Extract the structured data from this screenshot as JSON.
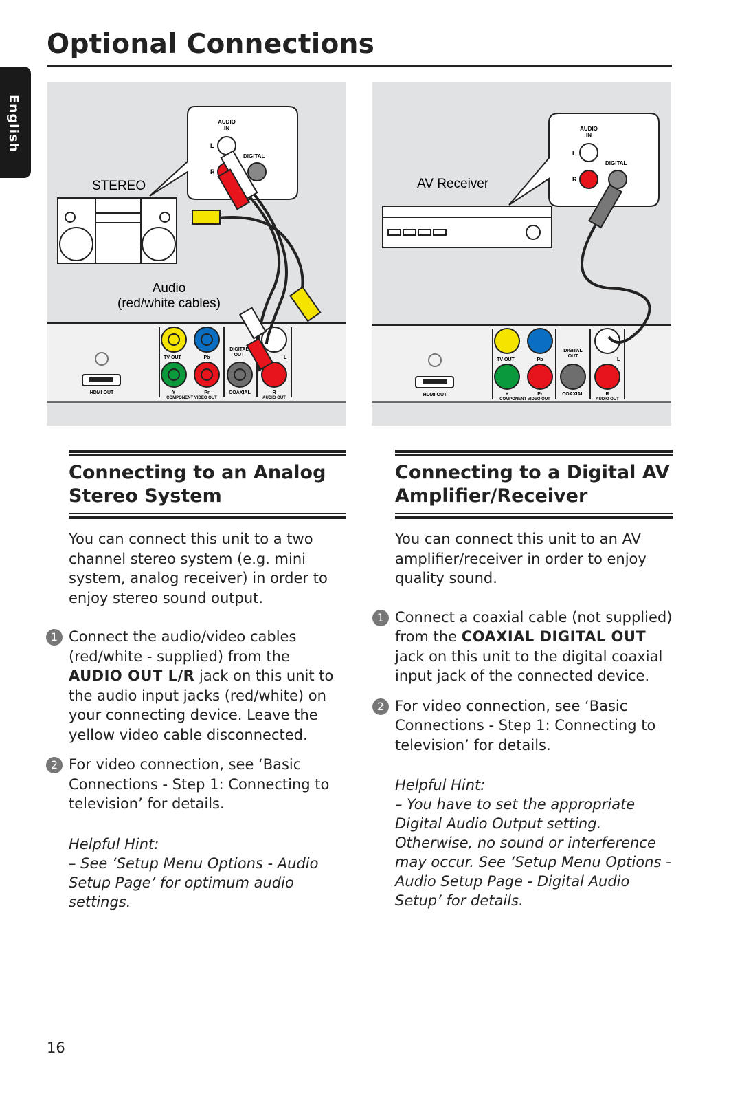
{
  "page": {
    "title": "Optional Connections",
    "language_tab": "English",
    "page_number": "16"
  },
  "diagram_left": {
    "device_label": "STEREO",
    "cable_label_1": "Audio",
    "cable_label_2": "(red/white cables)",
    "audio_in": "AUDIO",
    "audio_in2": "IN",
    "l": "L",
    "r": "R",
    "digital": "DIGITAL",
    "panel": {
      "hdmi": "HDMI OUT",
      "tv_out": "TV OUT",
      "pb": "Pb",
      "y": "Y",
      "pr": "Pr",
      "component": "COMPONENT VIDEO OUT",
      "digital_out1": "DIGITAL",
      "digital_out2": "OUT",
      "coaxial": "COAXIAL",
      "l": "L",
      "r": "R",
      "audio_out": "AUDIO OUT"
    }
  },
  "diagram_right": {
    "device_label": "AV Receiver",
    "audio_in": "AUDIO",
    "audio_in2": "IN",
    "l": "L",
    "r": "R",
    "digital": "DIGITAL",
    "panel": {
      "hdmi": "HDMI OUT",
      "tv_out": "TV OUT",
      "pb": "Pb",
      "y": "Y",
      "pr": "Pr",
      "component": "COMPONENT VIDEO OUT",
      "digital_out1": "DIGITAL",
      "digital_out2": "OUT",
      "coaxial": "COAXIAL",
      "l": "L",
      "r": "R",
      "audio_out": "AUDIO OUT"
    }
  },
  "colors": {
    "yellow": "#f5e400",
    "blue": "#0a6fc2",
    "green": "#0a9a3c",
    "red": "#e8141c",
    "gray": "#6e6e6e",
    "panel_bg": "#e1e2e4"
  },
  "left": {
    "heading_1": "Connecting to an Analog",
    "heading_2": "Stereo System",
    "intro": "You can connect this unit to a two channel stereo system (e.g. mini system, analog receiver) in order to enjoy stereo sound output.",
    "step1": {
      "num": "1",
      "a": "Connect the audio/video cables (red/white - supplied) from the ",
      "bold": "AUDIO OUT L/R",
      "b": " jack on this unit to the audio input jacks (red/white) on your connecting device. Leave the yellow video cable disconnected."
    },
    "step2": {
      "num": "2",
      "text": "For video connection, see ‘Basic Connections - Step 1: Connecting to television’ for details."
    },
    "hint_title": "Helpful Hint:",
    "hint": "–   See ‘Setup Menu Options - Audio Setup Page’ for optimum audio settings."
  },
  "right": {
    "heading_1": "Connecting to a Digital AV",
    "heading_2": "Amplifier/Receiver",
    "intro": "You can connect this unit to an AV amplifier/receiver in order to enjoy quality sound.",
    "step1": {
      "num": "1",
      "a": "Connect a coaxial cable (not supplied) from the ",
      "bold": "COAXIAL DIGITAL OUT",
      "b": " jack on this unit to the digital coaxial input jack of the connected device."
    },
    "step2": {
      "num": "2",
      "text": "For video connection, see ‘Basic Connections - Step 1: Connecting to television’ for details."
    },
    "hint_title": "Helpful Hint:",
    "hint": "–   You have to set the appropriate Digital Audio Output setting. Otherwise, no sound or interference may occur. See ‘Setup Menu Options - Audio Setup Page - Digital Audio Setup’ for details."
  }
}
